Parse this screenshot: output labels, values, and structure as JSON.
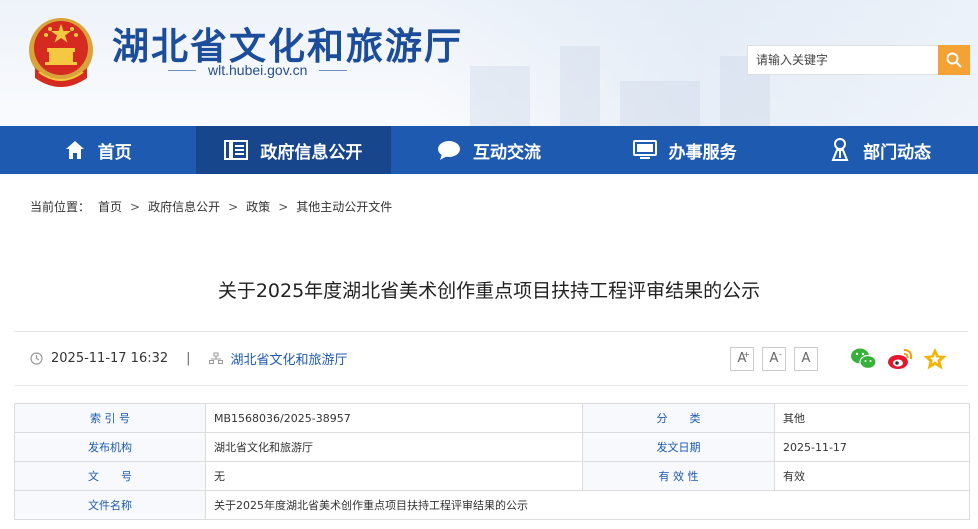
{
  "header": {
    "site_title": "湖北省文化和旅游厅",
    "site_url": "wlt.hubei.gov.cn",
    "search_placeholder": "请输入关键字"
  },
  "nav": {
    "items": [
      {
        "label": "首页",
        "icon": "home-icon"
      },
      {
        "label": "政府信息公开",
        "icon": "document-list-icon"
      },
      {
        "label": "互动交流",
        "icon": "speech-bubble-icon"
      },
      {
        "label": "办事服务",
        "icon": "monitor-icon"
      },
      {
        "label": "部门动态",
        "icon": "person-icon"
      }
    ],
    "active_index": 1
  },
  "breadcrumb": {
    "prefix": "当前位置：",
    "items": [
      "首页",
      "政府信息公开",
      "政策",
      "其他主动公开文件"
    ],
    "separator": ">"
  },
  "article": {
    "title": "关于2025年度湖北省美术创作重点项目扶持工程评审结果的公示",
    "datetime": "2025-11-17 16:32",
    "source": "湖北省文化和旅游厅",
    "font_buttons": [
      "A",
      "A",
      "A"
    ]
  },
  "info_table": {
    "rows": [
      {
        "label1": "索 引 号",
        "value1": "MB1568036/2025-38957",
        "label2": "分　　类",
        "value2": "其他"
      },
      {
        "label1": "发布机构",
        "value1": "湖北省文化和旅游厅",
        "label2": "发文日期",
        "value2": "2025-11-17"
      },
      {
        "label1": "文　　号",
        "value1": "无",
        "label2": "有 效 性",
        "value2": "有效"
      },
      {
        "label1": "文件名称",
        "value1": "关于2025年度湖北省美术创作重点项目扶持工程评审结果的公示"
      }
    ]
  },
  "colors": {
    "brand_blue": "#1e5ab0",
    "nav_active": "#17468c",
    "search_button": "#f4a233",
    "wechat": "#36b23a",
    "weibo": "#e6162d",
    "favorite": "#f4b400"
  }
}
